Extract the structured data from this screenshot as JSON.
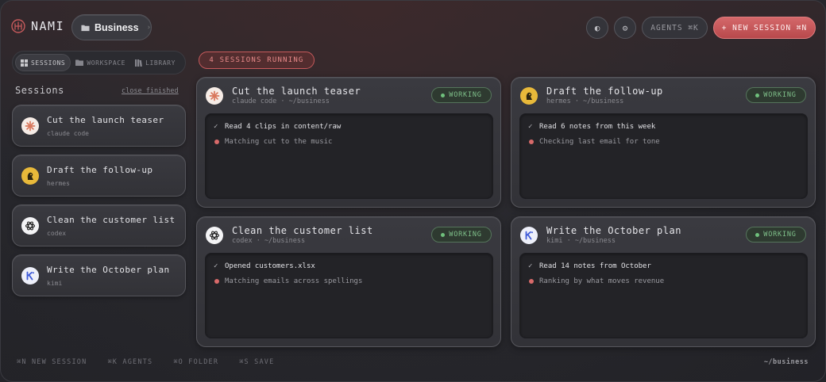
{
  "brand": {
    "name": "NAMI"
  },
  "workspace": {
    "label": "Business",
    "icon": "folder-icon"
  },
  "header": {
    "theme_icon": "contrast-icon",
    "settings_icon": "gear-icon",
    "agents_label": "AGENTS ⌘K",
    "new_session_label": "+ NEW SESSION ⌘N"
  },
  "nav": {
    "tabs": [
      {
        "label": "SESSIONS",
        "icon": "grid-icon",
        "active": true
      },
      {
        "label": "WORKSPACE",
        "icon": "folder-icon",
        "active": false
      },
      {
        "label": "LIBRARY",
        "icon": "books-icon",
        "active": false
      }
    ]
  },
  "sidebar": {
    "title": "Sessions",
    "close_finished": "close finished",
    "items": [
      {
        "title": "Cut the launch teaser",
        "agent": "claude code",
        "avatar": "claude-icon"
      },
      {
        "title": "Draft the follow-up",
        "agent": "hermes",
        "avatar": "hermes-icon"
      },
      {
        "title": "Clean the customer list",
        "agent": "codex",
        "avatar": "codex-icon"
      },
      {
        "title": "Write the October plan",
        "agent": "kimi",
        "avatar": "kimi-icon"
      }
    ]
  },
  "running": {
    "label": "4 SESSIONS RUNNING"
  },
  "cards": [
    {
      "title": "Cut the launch teaser",
      "subtitle": "claude code · ~/business",
      "status": "WORKING",
      "done": "Read 4 clips in content/raw",
      "active": "Matching cut to the music"
    },
    {
      "title": "Draft the follow-up",
      "subtitle": "hermes · ~/business",
      "status": "WORKING",
      "done": "Read 6 notes from this week",
      "active": "Checking last email for tone"
    },
    {
      "title": "Clean the customer list",
      "subtitle": "codex · ~/business",
      "status": "WORKING",
      "done": "Opened customers.xlsx",
      "active": "Matching emails across spellings"
    },
    {
      "title": "Write the October plan",
      "subtitle": "kimi · ~/business",
      "status": "WORKING",
      "done": "Read 14 notes from October",
      "active": "Ranking by what moves revenue"
    }
  ],
  "footer": {
    "shortcuts": [
      "⌘N NEW SESSION",
      "⌘K AGENTS",
      "⌘O FOLDER",
      "⌘S SAVE"
    ],
    "path": "~/business"
  },
  "colors": {
    "accent": "#c65a5c",
    "working": "#7fc08a",
    "active_dot": "#d86a6a",
    "claude": "#d9775c",
    "hermes": "#e8b93a",
    "kimi": "#3f5bd9"
  }
}
